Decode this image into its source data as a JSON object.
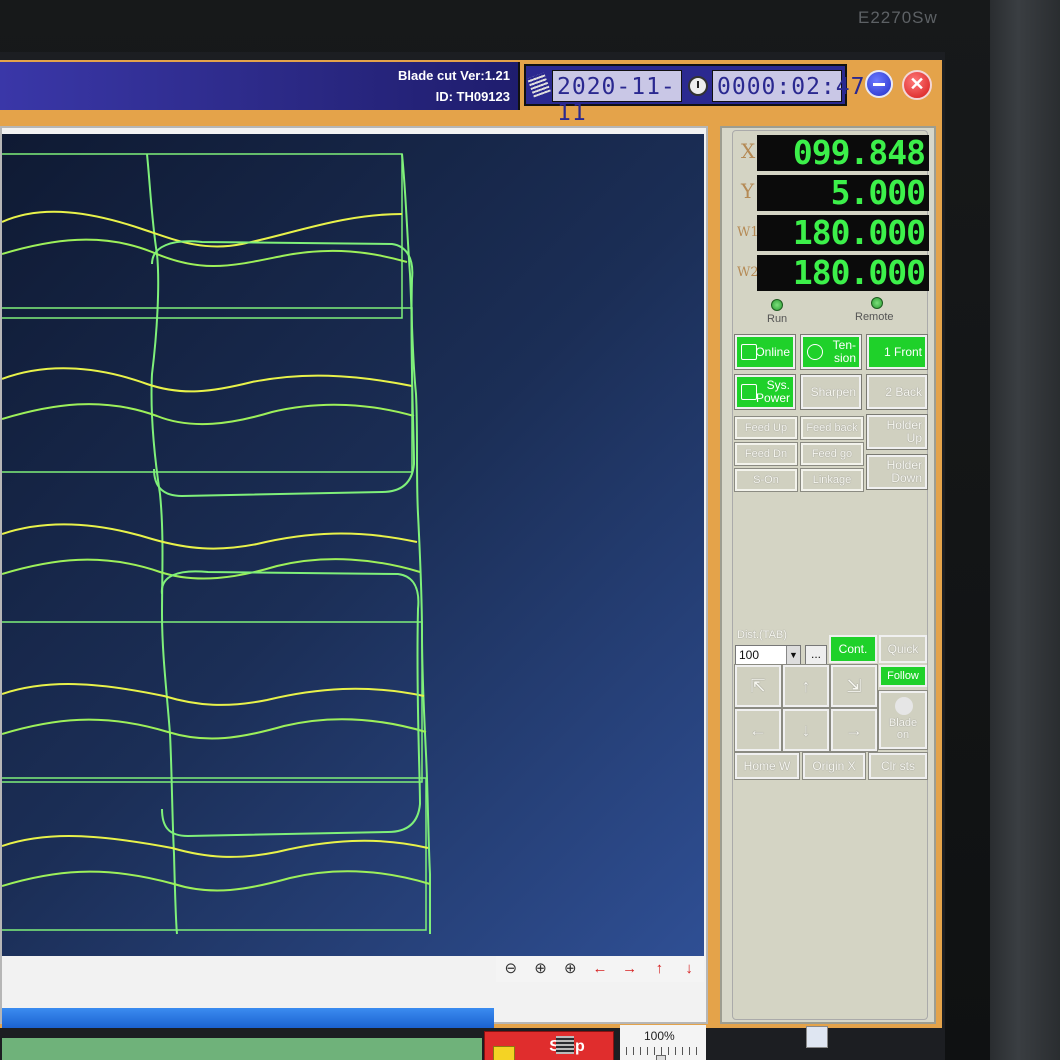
{
  "monitor": {
    "model_label": "E2270Sw"
  },
  "app": {
    "version": "Blade cut Ver:1.21",
    "id": "ID: TH09123",
    "date": "2020-11-11",
    "time": "0000:02:47",
    "close_glyph": "✕"
  },
  "coordinates": [
    {
      "axis": "X",
      "value": "099.848"
    },
    {
      "axis": "Y",
      "value": "5.000"
    },
    {
      "axis": "W1",
      "value": "180.000"
    },
    {
      "axis": "W2",
      "value": "180.000"
    }
  ],
  "indicators": {
    "run": "Run",
    "remote": "Remote"
  },
  "buttons": {
    "online": "Online",
    "tension": "Ten-\nsion",
    "front": "1 Front",
    "sys_power": "Sys.\nPower",
    "sharpen": "Sharpen",
    "back": "2 Back",
    "feed_up": "Feed Up",
    "feed_back": "Feed back",
    "holder_up": "Holder\nUp",
    "feed_down": "Feed Dn",
    "feed_go": "Feed go",
    "s_on": "S-On",
    "linkage": "Linkage",
    "holder_down": "Holder\nDown"
  },
  "dist": {
    "label": "Dist.(TAB)",
    "value": "100",
    "more": "...",
    "cont": "Cont.",
    "quick": "Quick",
    "follow": "Follow"
  },
  "jog": {
    "blade_on": "Blade\non"
  },
  "bottom_buttons": {
    "home_w": "Home W",
    "origin_x": "Origin X",
    "clr_sts": "Clr sts"
  },
  "stop": {
    "label": "Stop\n(ESC)"
  },
  "zoom": {
    "percent": "100%"
  },
  "toolbar": {
    "icons": [
      "zoom-out-icon",
      "zoom-fit-icon",
      "zoom-in-icon",
      "arrow-left-icon",
      "arrow-right-icon",
      "arrow-up-icon",
      "arrow-down-icon"
    ],
    "glyphs": [
      "⊖",
      "⊕",
      "⊕",
      "←",
      "→",
      "↑",
      "↓"
    ]
  },
  "colors": {
    "accent_green": "#1fd12a",
    "lcd_green": "#3cf04a",
    "stop_red": "#e02d2d",
    "frame_orange": "#e4a34a",
    "title_blue": "#2a2883",
    "path_green": "#7ff07a",
    "path_yellow": "#e8f24a"
  }
}
